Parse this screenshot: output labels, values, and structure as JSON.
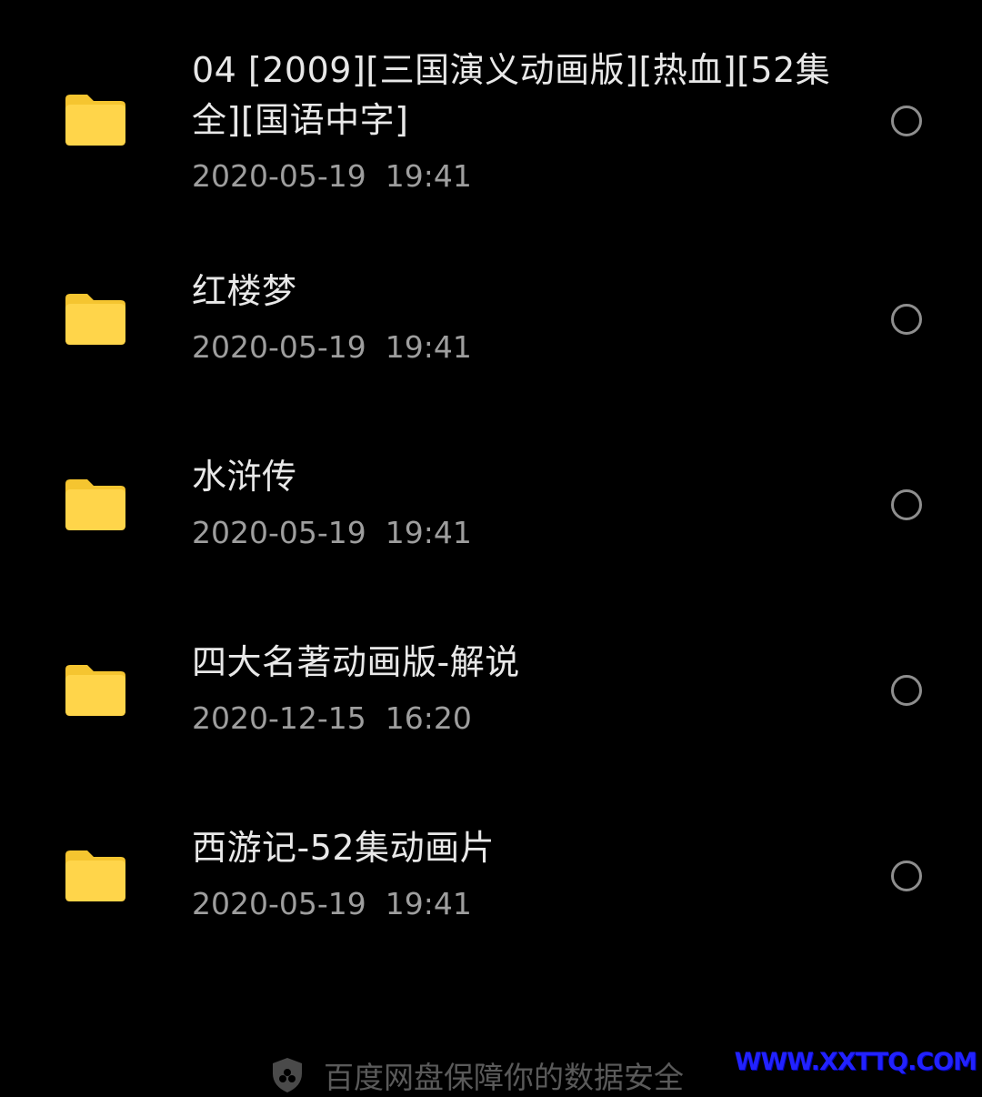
{
  "files": [
    {
      "name": "04 [2009][三国演义动画版][热血][52集全][国语中字]",
      "date": "2020-05-19  19:41",
      "icon": "folder-icon"
    },
    {
      "name": "红楼梦",
      "date": "2020-05-19  19:41",
      "icon": "folder-icon"
    },
    {
      "name": "水浒传",
      "date": "2020-05-19  19:41",
      "icon": "folder-icon"
    },
    {
      "name": "四大名著动画版-解说",
      "date": "2020-12-15  16:20",
      "icon": "folder-icon"
    },
    {
      "name": "西游记-52集动画片",
      "date": "2020-05-19  19:41",
      "icon": "folder-icon"
    }
  ],
  "footer": {
    "icon": "shield-icon",
    "text": "百度网盘保障你的数据安全"
  },
  "watermark": {
    "text": "WWW.XXTTQ.COM"
  },
  "colors": {
    "background": "#000000",
    "folder": "#FFD54A",
    "folder_tab": "#F5C530",
    "title_text": "#e8e8e8",
    "date_text": "#9e9e9e",
    "radio": "#8e8e8e",
    "watermark": "#2222ff"
  }
}
